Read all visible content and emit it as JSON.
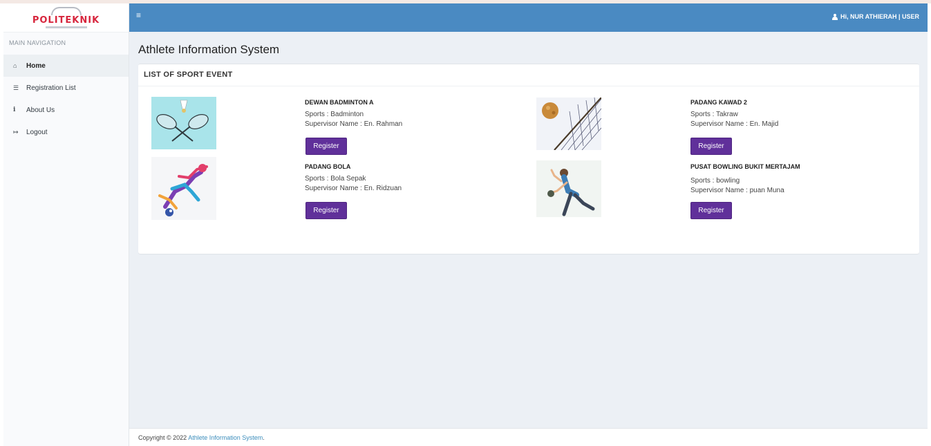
{
  "brand": {
    "logo_text": "POLITEKNIK"
  },
  "sidebar": {
    "header": "MAIN NAVIGATION",
    "items": [
      {
        "label": "Home",
        "icon": "home-icon",
        "glyph": "⌂",
        "active": true
      },
      {
        "label": "Registration List",
        "icon": "list-icon",
        "glyph": "☰",
        "active": false
      },
      {
        "label": "About Us",
        "icon": "info-icon",
        "glyph": "i",
        "active": false
      },
      {
        "label": "Logout",
        "icon": "sign-out-icon",
        "glyph": "↦",
        "active": false
      }
    ]
  },
  "header": {
    "menu_glyph": "≡",
    "user_text": "Hi, NUR ATHIERAH | USER"
  },
  "page": {
    "title": "Athlete Information System"
  },
  "events_box": {
    "title": "LIST OF SPORT EVENT",
    "events": [
      {
        "name": "DEWAN BADMINTON A",
        "sports": "Sports : Badminton",
        "supervisor": "Supervisor Name : En. Rahman",
        "button": "Register",
        "image": "badminton-image"
      },
      {
        "name": "PADANG KAWAD 2",
        "sports": "Sports : Takraw",
        "supervisor": "Supervisor Name : En. Majid",
        "button": "Register",
        "image": "takraw-image"
      },
      {
        "name": "PADANG BOLA",
        "sports": "Sports : Bola Sepak",
        "supervisor": "Supervisor Name : En. Ridzuan",
        "button": "Register",
        "image": "football-image"
      },
      {
        "name": "PUSAT BOWLING BUKIT MERTAJAM",
        "sports": "Sports : bowling",
        "supervisor": "Supervisor Name : puan Muna",
        "button": "Register",
        "image": "bowling-image"
      }
    ]
  },
  "footer": {
    "copyright": "Copyright © 2022 ",
    "brand": "Athlete Information System",
    "suffix": "."
  },
  "colors": {
    "header": "#4a8ac2",
    "button": "#60309a",
    "content_bg": "#ecf0f5",
    "link": "#3c8dbc"
  }
}
